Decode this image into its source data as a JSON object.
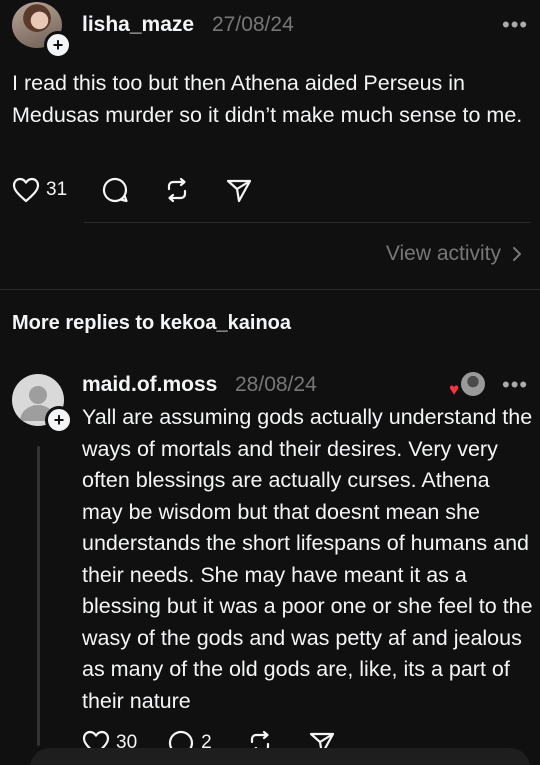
{
  "post1": {
    "username": "lisha_maze",
    "date": "27/08/24",
    "more_icon": "more-dots-icon",
    "text": "I read this too but then Athena aided Perseus in Medusas murder so it didn’t make much sense to me.",
    "likes": "31",
    "icons": [
      "heart-icon",
      "comment-icon",
      "repost-icon",
      "share-icon"
    ]
  },
  "view_activity": {
    "label": "View activity",
    "icon": "chevron-right-icon"
  },
  "section": {
    "title": "More replies to kekoa_kainoa"
  },
  "post2": {
    "username": "maid.of.moss",
    "date": "28/08/24",
    "text": "Yall are assuming gods actually understand the ways of mortals and their desires. Very very often blessings are actually curses. Athena may be wisdom but that doesnt mean she understands the short lifespans of humans and their needs. She may have meant it as a blessing but it was a poor one or she feel to the wasy of the gods and was petty af and jealous as many of the old gods are, like, its a part of their nature",
    "likes": "30",
    "comments": "2",
    "colors": {
      "heart_badge": "#ff3040"
    }
  }
}
